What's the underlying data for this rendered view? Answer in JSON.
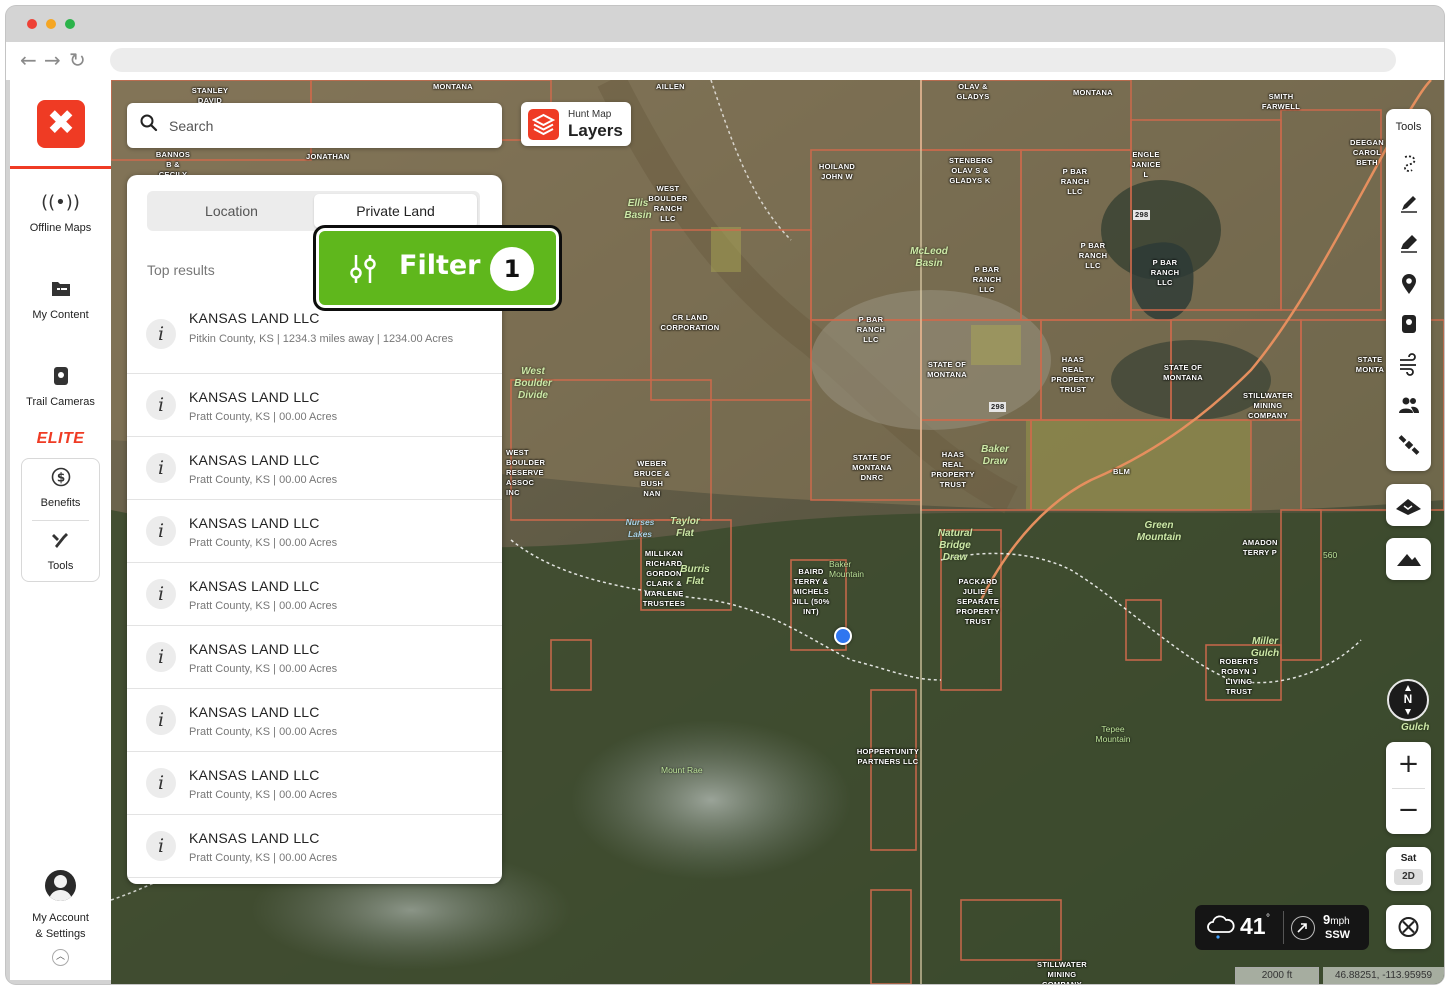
{
  "window": {
    "traffic_lights": [
      "#ee4136",
      "#f5a623",
      "#2bb34a"
    ],
    "nav": [
      "←",
      "→",
      "↻"
    ]
  },
  "sidebar": {
    "brand_color": "#ef3b24",
    "items": [
      {
        "label": "Offline Maps",
        "icon": "offline-signal-icon"
      },
      {
        "label": "My Content",
        "icon": "folder-icon"
      },
      {
        "label": "Trail Cameras",
        "icon": "camera-icon"
      }
    ],
    "elite_label": "ELITE",
    "elite_items": [
      {
        "label": "Benefits",
        "icon": "dollar-icon"
      },
      {
        "label": "Tools",
        "icon": "tools-icon"
      }
    ],
    "account_line1": "My Account",
    "account_line2": "& Settings"
  },
  "search": {
    "placeholder": "Search"
  },
  "layers_button": {
    "small": "Hunt Map",
    "big": "Layers"
  },
  "results_panel": {
    "tabs": [
      {
        "label": "Location",
        "active": false
      },
      {
        "label": "Private Land",
        "active": true
      }
    ],
    "section_label": "Top results",
    "results": [
      {
        "title": "KANSAS LAND LLC",
        "subtitle": "Pitkin County, KS  |  1234.3 miles away  |  1234.00 Acres"
      },
      {
        "title": "KANSAS LAND LLC",
        "subtitle": "Pratt County, KS  |  00.00 Acres"
      },
      {
        "title": "KANSAS LAND LLC",
        "subtitle": "Pratt County, KS  |  00.00 Acres"
      },
      {
        "title": "KANSAS LAND LLC",
        "subtitle": "Pratt County, KS  |  00.00 Acres"
      },
      {
        "title": "KANSAS LAND LLC",
        "subtitle": "Pratt County, KS  |  00.00 Acres"
      },
      {
        "title": "KANSAS LAND LLC",
        "subtitle": "Pratt County, KS  |  00.00 Acres"
      },
      {
        "title": "KANSAS LAND LLC",
        "subtitle": "Pratt County, KS  |  00.00 Acres"
      },
      {
        "title": "KANSAS LAND LLC",
        "subtitle": "Pratt County, KS  |  00.00 Acres"
      },
      {
        "title": "KANSAS LAND LLC",
        "subtitle": "Pratt County, KS  |  00.00 Acres"
      }
    ]
  },
  "filter_button": {
    "label": "Filter",
    "count": "1",
    "color": "#5fb71c"
  },
  "tools_panel": {
    "title": "Tools",
    "icons": [
      "lasso-icon",
      "pencil-icon",
      "marker-pen-icon",
      "location-pin-icon",
      "trail-camera-icon",
      "wind-icon",
      "group-icon",
      "satellite-icon"
    ]
  },
  "map_controls": {
    "compass": "N",
    "zoom_in": "+",
    "zoom_out": "−",
    "basemap": "Sat",
    "mode": "2D"
  },
  "weather": {
    "temp": "41",
    "deg": "°",
    "wind_speed": "9",
    "wind_unit": "mph",
    "wind_dir": "SSW"
  },
  "scale": "2000 ft",
  "coordinates": "46.88251, -113.95959",
  "map_labels": {
    "ownership": [
      "STANLEY DAVID",
      "MONTANA",
      "AILLEN",
      "OLAV & GLADYS",
      "MONTANA",
      "SMITH FARWELL",
      "BANNOS B & CECILY",
      "JONATHAN",
      "DEEGAN CAROL BETH",
      "HOILAND JOHN W",
      "STENBERG OLAV S & GLADYS K",
      "P BAR RANCH LLC",
      "ENGLE JANICE L",
      "WEST BOULDER RANCH LLC",
      "P BAR RANCH LLC",
      "P BAR RANCH LLC",
      "P BAR RANCH LLC",
      "CR LAND CORPORATION",
      "P BAR RANCH LLC",
      "STATE OF MONTANA",
      "HAAS REAL PROPERTY TRUST",
      "STATE OF MONTANA",
      "STATE MONTA",
      "STILLWATER MINING COMPANY",
      "WEST BOULDER RESERVE ASSOC INC",
      "WEBER BRUCE & BUSH NAN",
      "STATE OF MONTANA DNRC",
      "HAAS REAL PROPERTY TRUST",
      "BLM",
      "AMADON TERRY P",
      "MILLIKAN RICHARD GORDON CLARK & MARLENE TRUSTEES",
      "BAIRD TERRY & MICHELS JILL (50% INT)",
      "PACKARD JULIE E SEPARATE PROPERTY TRUST",
      "ROBERTS ROBYN J LIVING TRUST",
      "HOPPERTUNITY PARTNERS LLC",
      "STILLWATER MINING COMPANY"
    ],
    "places": [
      "Ellis Basin",
      "McLeod Basin",
      "West Boulder Divide",
      "Baker Draw",
      "Green Mountain",
      "Taylor Flat",
      "Burris Flat",
      "Natural Bridge Draw",
      "Miller Gulch",
      "Nurses Lakes",
      "Gulch"
    ],
    "peaks": [
      "Baker Mountain",
      "Tepee Mountain",
      "Mount Rae",
      "560"
    ],
    "roads": [
      "298",
      "298"
    ]
  }
}
